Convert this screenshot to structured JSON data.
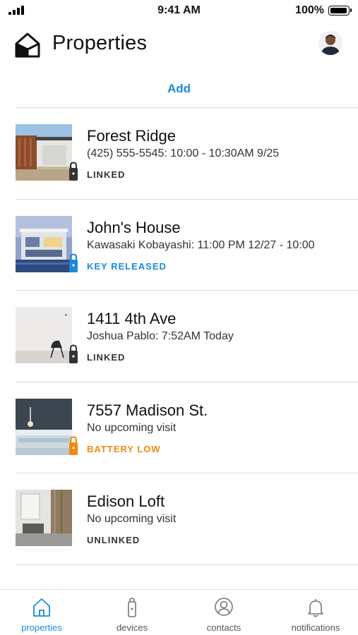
{
  "status_bar": {
    "time": "9:41 AM",
    "battery": "100%",
    "battery_level": 1.0
  },
  "header": {
    "title": "Properties",
    "logo_icon": "house-logo-icon",
    "avatar_icon": "user-avatar"
  },
  "actions": {
    "add_label": "Add"
  },
  "colors": {
    "accent": "#1b8bd8",
    "warning": "#f5890f",
    "neutral": "#333333",
    "divider": "#d9d9d9"
  },
  "properties": [
    {
      "name": "Forest Ridge",
      "detail": "(425) 555-5545: 10:00 - 10:30AM 9/25",
      "status": "LINKED",
      "status_color": "#333333",
      "lock_color": "#333333",
      "lock_icon": "lock-icon"
    },
    {
      "name": "John's House",
      "detail": "Kawasaki Kobayashi: 11:00 PM 12/27 - 10:00",
      "status": "KEY RELEASED",
      "status_color": "#1b8bd8",
      "lock_color": "#1b8bd8",
      "lock_icon": "lock-icon"
    },
    {
      "name": "1411 4th Ave",
      "detail": "Joshua Pablo: 7:52AM Today",
      "status": "LINKED",
      "status_color": "#333333",
      "lock_color": "#333333",
      "lock_icon": "lock-icon"
    },
    {
      "name": "7557 Madison St.",
      "detail": "No upcoming visit",
      "status": "BATTERY LOW",
      "status_color": "#f5890f",
      "lock_color": "#f5890f",
      "lock_icon": "lock-icon"
    },
    {
      "name": "Edison Loft",
      "detail": "No upcoming visit",
      "status": "UNLINKED",
      "status_color": "#333333",
      "lock_color": null,
      "lock_icon": null
    }
  ],
  "tabs": [
    {
      "label": "properties",
      "icon": "home-icon",
      "active": true
    },
    {
      "label": "devices",
      "icon": "lock-device-icon",
      "active": false
    },
    {
      "label": "contacts",
      "icon": "contact-icon",
      "active": false
    },
    {
      "label": "notifications",
      "icon": "bell-icon",
      "active": false
    }
  ]
}
